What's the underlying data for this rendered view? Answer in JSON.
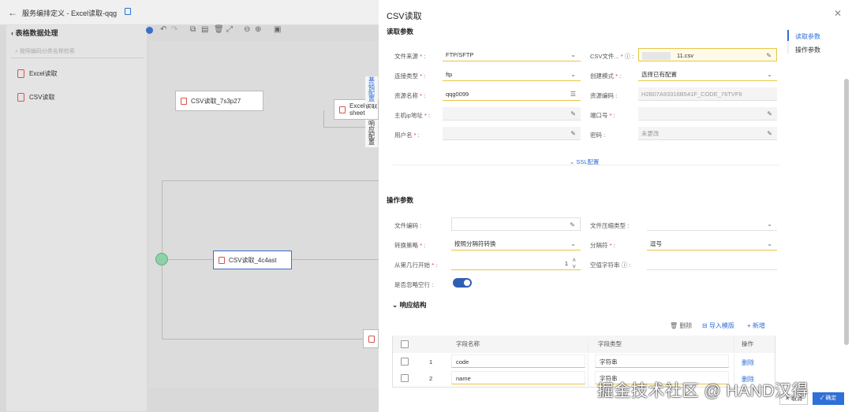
{
  "app": {
    "title": "服务编排定义 - Excel读取-qqg",
    "panel_title": "表格数据处理",
    "search_placeholder": "按照编码分类名称检索",
    "palette": [
      {
        "label": "Excel读取"
      },
      {
        "label": "CSV读取"
      }
    ]
  },
  "canvas": {
    "nodes": {
      "csv1": "CSV读取_7s3p27",
      "excel": "Excel读取",
      "excel_sub": "sheet",
      "csv2": "CSV读取_4c4ast"
    },
    "side_tabs": [
      "基础配置",
      "响应配置"
    ]
  },
  "drawer": {
    "title": "CSV读取",
    "anchors": [
      "读取参数",
      "操作参数"
    ],
    "read_section": "读取参数",
    "fields": {
      "file_source": {
        "label": "文件来源",
        "value": "FTP/SFTP"
      },
      "csv_file": {
        "label": "CSV文件...",
        "value": "11.csv"
      },
      "conn_type": {
        "label": "连接类型",
        "value": "ftp"
      },
      "create_mode": {
        "label": "创建模式",
        "value": "选择已有配置"
      },
      "resource_name": {
        "label": "资源名称",
        "value": "qqg0099"
      },
      "resource_code": {
        "label": "资源编码",
        "value": "H2B07A93316B541F_CODE_76TVF9"
      },
      "host": {
        "label": "主机ip地址",
        "value": ""
      },
      "port": {
        "label": "端口号",
        "value": ""
      },
      "username": {
        "label": "用户名",
        "value": ""
      },
      "password": {
        "label": "密码",
        "value": "未更改"
      }
    },
    "ssl_label": "SSL配置",
    "op_section": "操作参数",
    "op_fields": {
      "encoding": {
        "label": "文件编码",
        "value": ""
      },
      "compress": {
        "label": "文件压缩类型",
        "value": ""
      },
      "strategy": {
        "label": "转换策略",
        "value": "按照分隔符转换"
      },
      "delimiter": {
        "label": "分隔符",
        "value": "逗号"
      },
      "start_row": {
        "label": "从第几行开始",
        "value": "1"
      },
      "null_string": {
        "label": "空值字符串",
        "value": ""
      },
      "skip_blank": {
        "label": "是否忽略空行",
        "value": true
      }
    },
    "response_title": "响应结构",
    "table_actions": {
      "delete": "删除",
      "import": "导入模版",
      "add": "新增"
    },
    "table": {
      "headers": [
        "字段名称",
        "字段类型",
        "操作"
      ],
      "rows": [
        {
          "index": "1",
          "name": "code",
          "type": "字符串",
          "op": "删除"
        },
        {
          "index": "2",
          "name": "name",
          "type": "字符串",
          "op": "删除"
        }
      ]
    },
    "footer": {
      "cancel": "取消",
      "ok": "确定"
    }
  },
  "watermark": "掘金技术社区 @ HAND汉得"
}
